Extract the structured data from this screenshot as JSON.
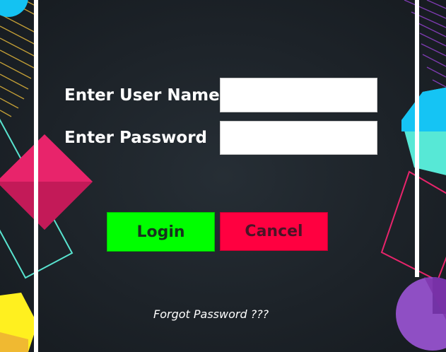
{
  "login_form": {
    "username_label": "Enter User Name",
    "username_value": "",
    "password_label": "Enter Password",
    "password_value": "",
    "login_button": "Login",
    "cancel_button": "Cancel",
    "forgot_password_link": "Forgot Password ???"
  },
  "colors": {
    "background": "#1d2329",
    "login_button": "#00ff00",
    "cancel_button": "#ff0040",
    "accent_pink": "#e8246b",
    "accent_cyan": "#17c3f0",
    "accent_teal": "#57e0cc",
    "accent_yellow": "#fff01f",
    "accent_purple": "#7b3bb0"
  },
  "decorations": [
    "cyan-circle-icon",
    "yellow-hatch-lines-icon",
    "teal-outline-square-icon",
    "pink-diamond-icon",
    "yellow-hexagon-icon",
    "purple-hatch-lines-icon",
    "cyan-hexagon-icon",
    "pink-outline-square-icon",
    "purple-circle-icon"
  ]
}
